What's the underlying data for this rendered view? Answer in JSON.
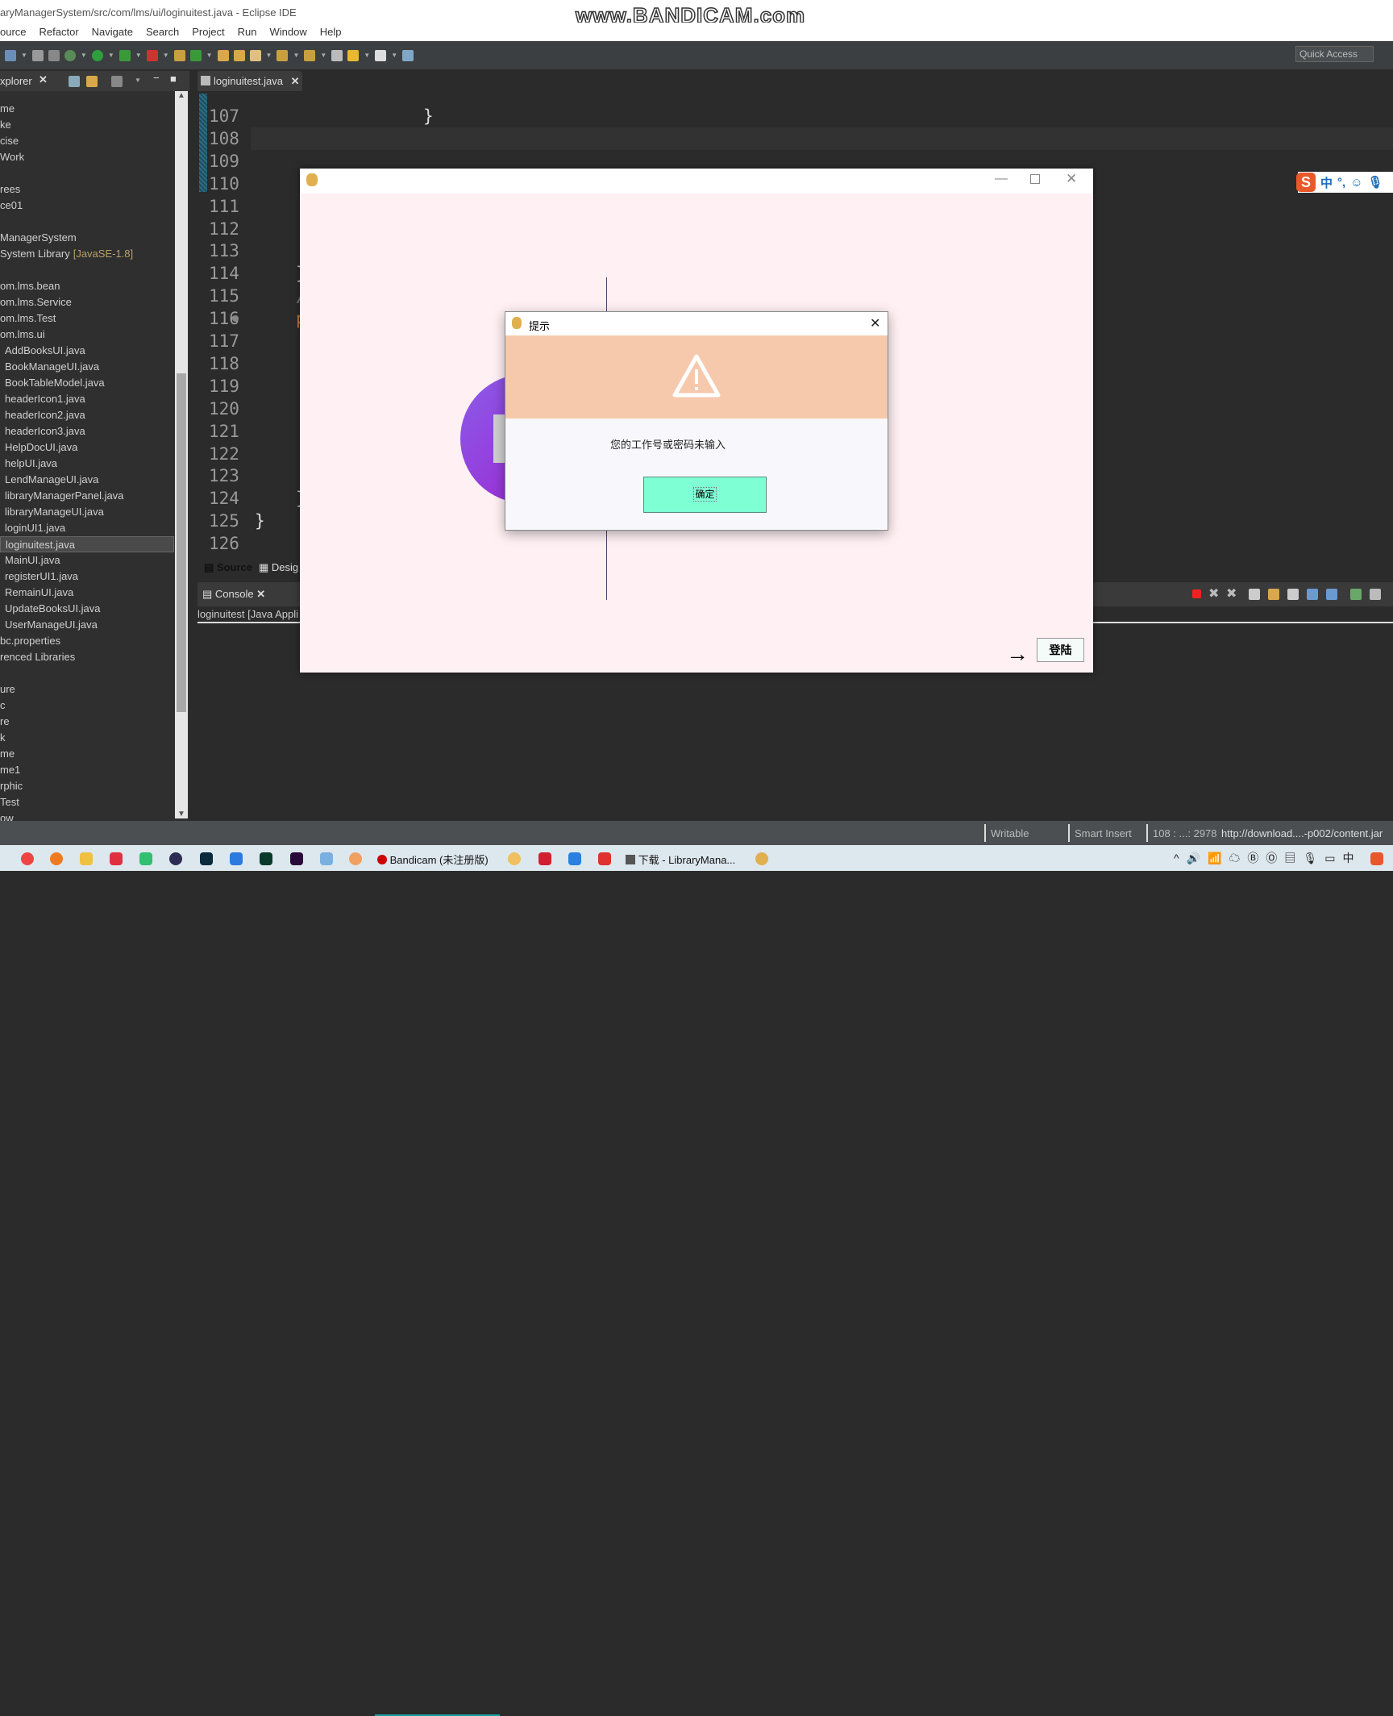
{
  "window": {
    "title": "aryManagerSystem/src/com/lms/ui/loginuitest.java - Eclipse IDE",
    "watermark": "www.BANDICAM.com"
  },
  "menu": [
    "ource",
    "Refactor",
    "Navigate",
    "Search",
    "Project",
    "Run",
    "Window",
    "Help"
  ],
  "quick_access": "Quick Access",
  "explorer": {
    "tab": "xplorer",
    "rows": [
      {
        "t": "me",
        "i": 0
      },
      {
        "t": "ke",
        "i": 1
      },
      {
        "t": "cise",
        "i": 2
      },
      {
        "t": "Work",
        "i": 3
      },
      {
        "t": "rees",
        "i": 5
      },
      {
        "t": "ce01",
        "i": 6
      },
      {
        "t": "ManagerSystem",
        "i": 8
      },
      {
        "t": "System Library",
        "lib": "[JavaSE-1.8]",
        "i": 9
      },
      {
        "t": "om.lms.bean",
        "i": 11
      },
      {
        "t": "om.lms.Service",
        "i": 12
      },
      {
        "t": "om.lms.Test",
        "i": 13
      },
      {
        "t": "om.lms.ui",
        "i": 14
      },
      {
        "t": "AddBooksUI.java",
        "i": 15,
        "f": 1
      },
      {
        "t": "BookManageUI.java",
        "i": 16,
        "f": 1
      },
      {
        "t": "BookTableModel.java",
        "i": 17,
        "f": 1
      },
      {
        "t": "headerIcon1.java",
        "i": 18,
        "f": 1
      },
      {
        "t": "headerIcon2.java",
        "i": 19,
        "f": 1
      },
      {
        "t": "headerIcon3.java",
        "i": 20,
        "f": 1
      },
      {
        "t": "HelpDocUI.java",
        "i": 21,
        "f": 1
      },
      {
        "t": "helpUI.java",
        "i": 22,
        "f": 1
      },
      {
        "t": "LendManageUI.java",
        "i": 23,
        "f": 1
      },
      {
        "t": "libraryManagerPanel.java",
        "i": 24,
        "f": 1
      },
      {
        "t": "libraryManageUI.java",
        "i": 25,
        "f": 1
      },
      {
        "t": "loginUI1.java",
        "i": 26,
        "f": 1
      },
      {
        "t": "loginuitest.java",
        "i": 27,
        "f": 1,
        "sel": 1
      },
      {
        "t": "MainUI.java",
        "i": 28,
        "f": 1
      },
      {
        "t": "registerUI1.java",
        "i": 29,
        "f": 1
      },
      {
        "t": "RemainUI.java",
        "i": 30,
        "f": 1
      },
      {
        "t": "UpdateBooksUI.java",
        "i": 31,
        "f": 1
      },
      {
        "t": "UserManageUI.java",
        "i": 32,
        "f": 1
      },
      {
        "t": "bc.properties",
        "i": 33
      },
      {
        "t": "renced Libraries",
        "i": 34
      },
      {
        "t": "ure",
        "i": 36
      },
      {
        "t": "c",
        "i": 37
      },
      {
        "t": "re",
        "i": 38
      },
      {
        "t": "k",
        "i": 39
      },
      {
        "t": "me",
        "i": 40
      },
      {
        "t": "me1",
        "i": 41
      },
      {
        "t": "rphic",
        "i": 42
      },
      {
        "t": "Test",
        "i": 43
      },
      {
        "t": "ow",
        "i": 44
      }
    ]
  },
  "editor": {
    "tab": "loginuitest.java",
    "lines": [
      107,
      108,
      109,
      110,
      111,
      112,
      113,
      114,
      115,
      116,
      117,
      118,
      119,
      120,
      121,
      122,
      123,
      124,
      125,
      126
    ],
    "code": [
      {
        "line": 107,
        "text": "}",
        "col": "indent3"
      },
      {
        "line": 114,
        "text": "}",
        "col": "indent1"
      },
      {
        "line": 115,
        "text": "/",
        "col": "indent1",
        "color": "#808080"
      },
      {
        "line": 116,
        "text": "p",
        "col": "indent1",
        "color": "#cc7832"
      },
      {
        "line": 124,
        "text": "}",
        "col": "indent1"
      },
      {
        "line": 125,
        "text": "}",
        "col": "indent0"
      }
    ],
    "source_tab": "Source",
    "design_tab": "Desig"
  },
  "console": {
    "tab": "Console",
    "text": "loginuitest [Java Appli"
  },
  "status": {
    "writable": "Writable",
    "insert": "Smart Insert",
    "position": "108 : ...: 2978",
    "url": "http://download....-p002/content.jar"
  },
  "taskbar": {
    "bandicam": "Bandicam (未注册版)",
    "download": "下载 - LibraryMana..."
  },
  "ime": {
    "lang": "中",
    "punct": "°,"
  },
  "login": {
    "button": "登陆",
    "arrow": "→"
  },
  "dialog": {
    "title": "提示",
    "message": "您的工作号或密码未输入",
    "ok": "确定",
    "colors": {
      "banner": "#f6c9ac",
      "ok_button": "#7fffd4"
    }
  }
}
